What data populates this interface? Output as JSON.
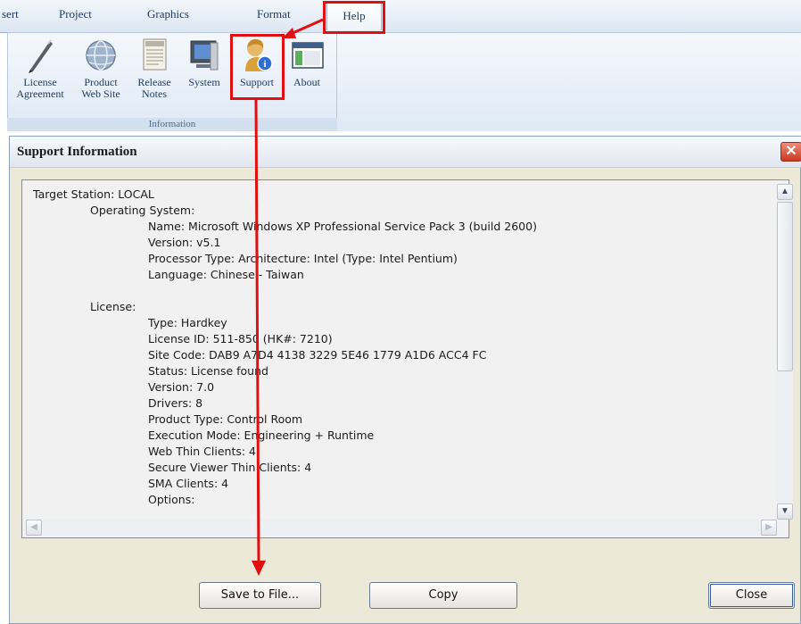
{
  "ribbon": {
    "tabs": [
      "sert",
      "Project",
      "Graphics",
      "Format",
      "Help"
    ],
    "group_label": "Information",
    "buttons": [
      {
        "line1": "License",
        "line2": "Agreement",
        "icon": "pen-icon"
      },
      {
        "line1": "Product",
        "line2": "Web Site",
        "icon": "globe-icon"
      },
      {
        "line1": "Release",
        "line2": "Notes",
        "icon": "notes-icon"
      },
      {
        "line1": "System",
        "line2": "",
        "icon": "computer-icon"
      },
      {
        "line1": "Support",
        "line2": "",
        "icon": "support-person-icon"
      },
      {
        "line1": "About",
        "line2": "",
        "icon": "window-icon"
      }
    ]
  },
  "dialog": {
    "title": "Support Information",
    "close_glyph": "✕",
    "lines": [
      "Target Station: LOCAL",
      "Operating System:",
      "Name: Microsoft Windows XP Professional Service Pack 3 (build 2600)",
      "Version: v5.1",
      "Processor Type: Architecture: Intel (Type: Intel Pentium)",
      "Language: Chinese - Taiwan",
      "",
      "License:",
      "Type: Hardkey",
      "License ID: 511-850 (HK#: 7210)",
      "Site Code: DAB9 A7D4 4138 3229 5E46 1779 A1D6 ACC4 FC",
      "Status: License found",
      "Version: 7.0",
      "Drivers: 8",
      "Product Type: Control Room",
      "Execution Mode: Engineering + Runtime",
      "Web Thin Clients: 4",
      "Secure Viewer Thin Clients: 4",
      "SMA Clients: 4",
      "Options:"
    ],
    "buttons": {
      "save": "Save to File...",
      "copy": "Copy",
      "close": "Close"
    }
  },
  "colors": {
    "annotation_red": "#e01010",
    "dialog_bg": "#ece9d8"
  }
}
